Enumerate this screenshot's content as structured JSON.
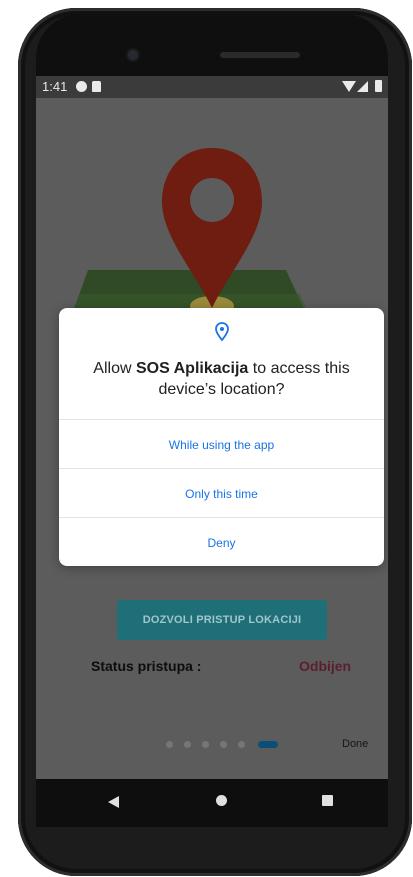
{
  "statusbar": {
    "time": "1:41"
  },
  "dialog": {
    "title_prefix": "Allow ",
    "app_name": "SOS Aplikacija",
    "title_suffix": " to access this device’s location?",
    "options": [
      {
        "label": "While using the app"
      },
      {
        "label": "Only this time"
      },
      {
        "label": "Deny"
      }
    ],
    "accent_color": "#1a73e8"
  },
  "main": {
    "primary_button": "DOZVOLI PRISTUP LOKACIJI",
    "status_label": "Status pristupa :",
    "status_value": "Odbijen"
  },
  "pager": {
    "total": 6,
    "active_index": 5,
    "done_label": "Done"
  },
  "colors": {
    "pin": "#6e1d10",
    "map": "#2f4a25",
    "button": "#1f6f78",
    "status_value": "#5a1f2e"
  }
}
